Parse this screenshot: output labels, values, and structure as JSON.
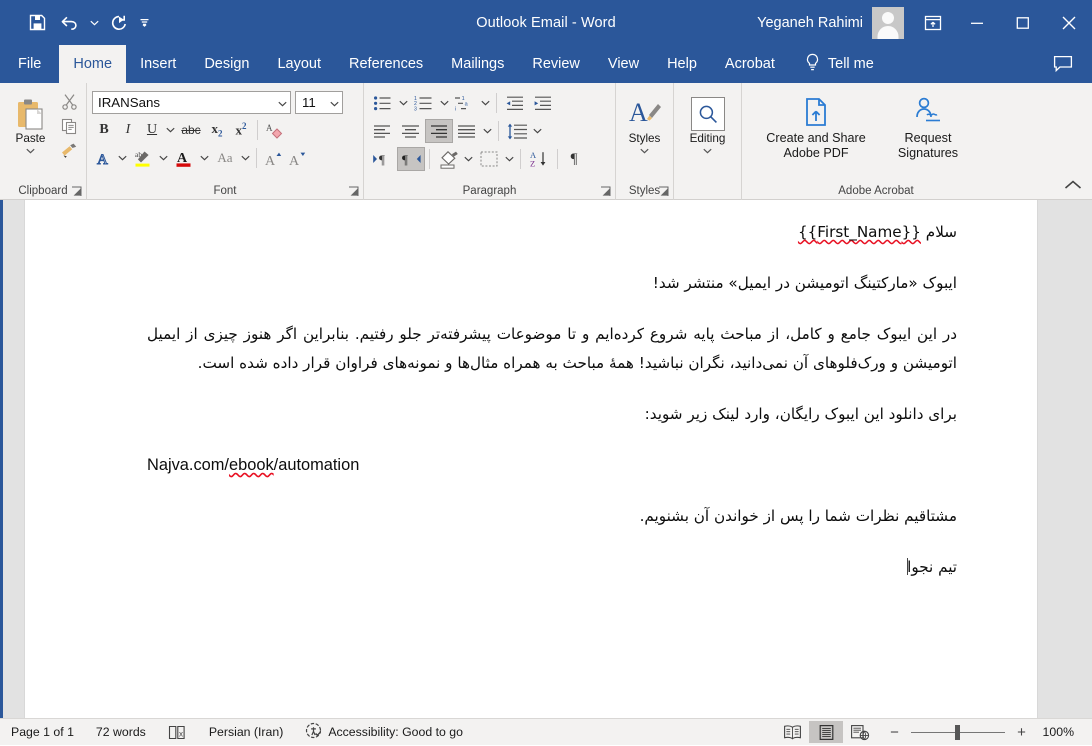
{
  "window": {
    "title": "Outlook Email  -  Word",
    "account_name": "Yeganeh Rahimi",
    "quick_access": [
      {
        "name": "save-icon",
        "label": "Save"
      },
      {
        "name": "undo-icon",
        "label": "Undo"
      },
      {
        "name": "redo-icon",
        "label": "Redo"
      },
      {
        "name": "customize-quick-access-icon",
        "label": "Customize Quick Access Toolbar"
      }
    ],
    "controls": [
      {
        "name": "ribbon-display-options",
        "label": "Ribbon Display Options"
      },
      {
        "name": "minimize",
        "label": "Minimize"
      },
      {
        "name": "maximize",
        "label": "Maximize"
      },
      {
        "name": "close",
        "label": "Close"
      }
    ],
    "accent_color": "#2b579a"
  },
  "tabs": [
    {
      "label": "File",
      "active": false
    },
    {
      "label": "Home",
      "active": true
    },
    {
      "label": "Insert",
      "active": false
    },
    {
      "label": "Design",
      "active": false
    },
    {
      "label": "Layout",
      "active": false
    },
    {
      "label": "References",
      "active": false
    },
    {
      "label": "Mailings",
      "active": false
    },
    {
      "label": "Review",
      "active": false
    },
    {
      "label": "View",
      "active": false
    },
    {
      "label": "Help",
      "active": false
    },
    {
      "label": "Acrobat",
      "active": false
    }
  ],
  "tell_me": {
    "label": "Tell me",
    "icon": "lightbulb-icon"
  },
  "comments_button": {
    "label": "Comments",
    "icon": "comment-icon"
  },
  "ribbon": {
    "clipboard": {
      "group_label": "Clipboard",
      "paste_label": "Paste",
      "cut_label": "Cut",
      "copy_label": "Copy",
      "format_painter_label": "Format Painter"
    },
    "font": {
      "group_label": "Font",
      "font_name": "IRANSans",
      "font_size": "11",
      "bold_label": "B",
      "italic_label": "I",
      "underline_label": "U",
      "strikethrough_label": "abc",
      "subscript_label": "x",
      "superscript_label": "x",
      "clear_formatting_label": "Clear All Formatting",
      "text_effects_label": "Text Effects and Typography",
      "highlight_label": "Text Highlight Color",
      "highlight_color": "#ffff00",
      "font_color_label": "Font Color",
      "font_color": "#d60a0a",
      "change_case_label": "Aa",
      "grow_font_label": "Increase Font Size",
      "shrink_font_label": "Decrease Font Size"
    },
    "paragraph": {
      "group_label": "Paragraph",
      "bullets_label": "Bullets",
      "numbering_label": "Numbering",
      "multilevel_label": "Multilevel List",
      "decrease_indent_label": "Decrease Indent",
      "increase_indent_label": "Increase Indent",
      "align_left_label": "Align Left",
      "align_center_label": "Center",
      "align_right_label": "Align Right",
      "justify_label": "Justify",
      "line_spacing_label": "Line and Paragraph Spacing",
      "ltr_label": "Left-to-Right Text Direction",
      "rtl_label": "Right-to-Left Text Direction",
      "shading_label": "Shading",
      "borders_label": "Borders",
      "sort_label": "Sort",
      "show_marks_label": "Show/Hide Formatting Marks",
      "active_alignment": "Align Right",
      "active_direction": "Right-to-Left"
    },
    "styles": {
      "group_label": "Styles",
      "label": "Styles"
    },
    "editing": {
      "group_label": "",
      "label": "Editing"
    },
    "acrobat": {
      "group_label": "Adobe Acrobat",
      "create_share_label": "Create and Share Adobe PDF",
      "request_signatures_label": "Request Signatures"
    },
    "collapse_label": "Collapse the Ribbon"
  },
  "document": {
    "paragraphs": [
      {
        "kind": "rtl",
        "segments": [
          {
            "text": "سلام ",
            "spell": false
          },
          {
            "text": "{{First_Name}}",
            "spell": true
          }
        ]
      },
      {
        "kind": "rtl",
        "segments": [
          {
            "text": "ایبوک «مارکتینگ اتومیشن در ایمیل» منتشر شد!",
            "spell": false
          }
        ]
      },
      {
        "kind": "rtl-block",
        "segments": [
          {
            "text": "در این ایبوک جامع و کامل، از مباحث پایه شروع کرده‌ایم و تا موضوعات پیشرفته‌تر جلو رفتیم. بنابراین اگر هنوز چیزی از ایمیل اتومیشن و ورک‌فلوهای آن نمی‌دانید، نگران نباشید! همهٔ مباحث به همراه مثال‌ها و نمونه‌های فراوان قرار داده شده است.",
            "spell": false
          }
        ]
      },
      {
        "kind": "rtl",
        "segments": [
          {
            "text": "برای دانلود این ایبوک رایگان، وارد لینک زیر شوید:",
            "spell": false
          }
        ]
      },
      {
        "kind": "ltr",
        "segments": [
          {
            "text": "Najva.com/",
            "spell": false
          },
          {
            "text": "ebook",
            "spell": true
          },
          {
            "text": "/automation",
            "spell": false
          }
        ]
      },
      {
        "kind": "rtl",
        "segments": [
          {
            "text": "مشتاقیم نظرات شما را پس از خواندن آن بشنویم.",
            "spell": false
          }
        ]
      },
      {
        "kind": "rtl-caret",
        "segments": [
          {
            "text": "تیم نجوا",
            "spell": false
          }
        ]
      }
    ]
  },
  "status_bar": {
    "page": "Page 1 of 1",
    "words": "72 words",
    "proofing_icon": "proofing-errors-icon",
    "language": "Persian (Iran)",
    "accessibility": "Accessibility: Good to go",
    "accessibility_icon": "accessibility-icon",
    "views": [
      {
        "name": "read-mode-view",
        "label": "Read Mode",
        "active": false
      },
      {
        "name": "print-layout-view",
        "label": "Print Layout",
        "active": true
      },
      {
        "name": "web-layout-view",
        "label": "Web Layout",
        "active": false
      }
    ],
    "zoom_out_label": "Zoom Out",
    "zoom_in_label": "Zoom In",
    "zoom_level": "100%"
  }
}
